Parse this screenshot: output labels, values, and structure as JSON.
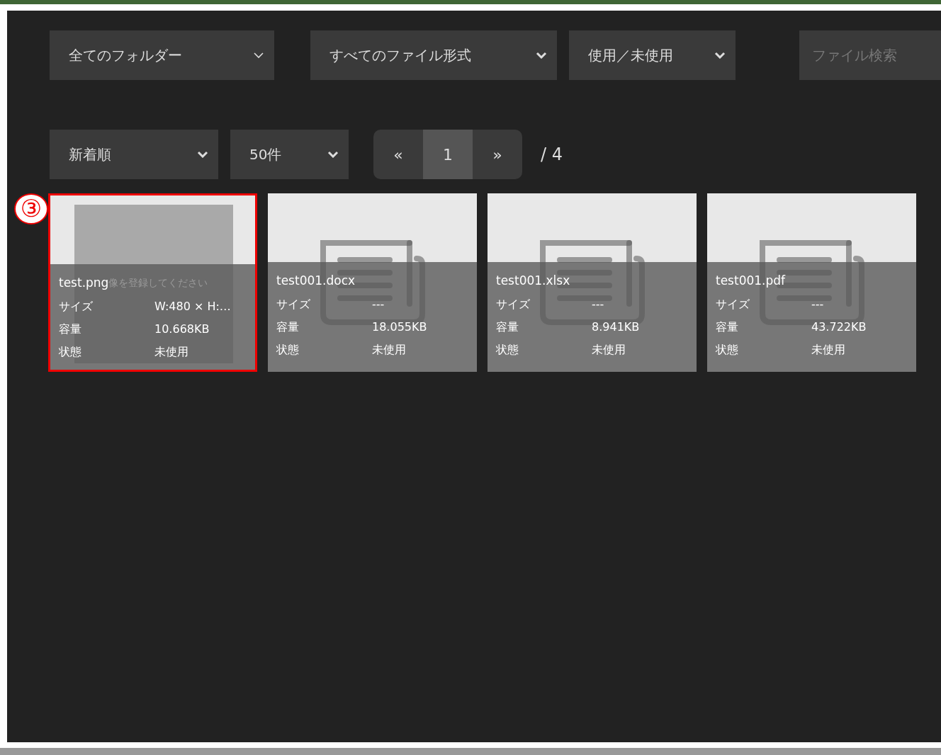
{
  "filters": [
    {
      "label": "全てのフォルダー"
    },
    {
      "label": "すべてのファイル形式"
    },
    {
      "label": "使用／未使用"
    }
  ],
  "search": {
    "placeholder": "ファイル検索"
  },
  "sort": {
    "label": "新着順"
  },
  "per_page": {
    "label": "50件"
  },
  "pagination": {
    "prev": "«",
    "pages": [
      {
        "label": "1",
        "selected": true
      }
    ],
    "next": "»",
    "total": "/ 4"
  },
  "callout": "③",
  "files": [
    {
      "kind": "image",
      "name": "test.png",
      "highlighted": true,
      "image_hint": "像を登録してください",
      "rows": [
        {
          "label": "サイズ",
          "value": "W:480 × H:…"
        },
        {
          "label": "容量",
          "value": "10.668KB"
        },
        {
          "label": "状態",
          "value": "未使用"
        }
      ]
    },
    {
      "kind": "document",
      "name": "test001.docx",
      "highlighted": false,
      "rows": [
        {
          "label": "サイズ",
          "value": "---"
        },
        {
          "label": "容量",
          "value": "18.055KB"
        },
        {
          "label": "状態",
          "value": "未使用"
        }
      ]
    },
    {
      "kind": "document",
      "name": "test001.xlsx",
      "highlighted": false,
      "rows": [
        {
          "label": "サイズ",
          "value": "---"
        },
        {
          "label": "容量",
          "value": "8.941KB"
        },
        {
          "label": "状態",
          "value": "未使用"
        }
      ]
    },
    {
      "kind": "document",
      "name": "test001.pdf",
      "highlighted": false,
      "rows": [
        {
          "label": "サイズ",
          "value": "---"
        },
        {
          "label": "容量",
          "value": "43.722KB"
        },
        {
          "label": "状態",
          "value": "未使用"
        }
      ]
    }
  ]
}
